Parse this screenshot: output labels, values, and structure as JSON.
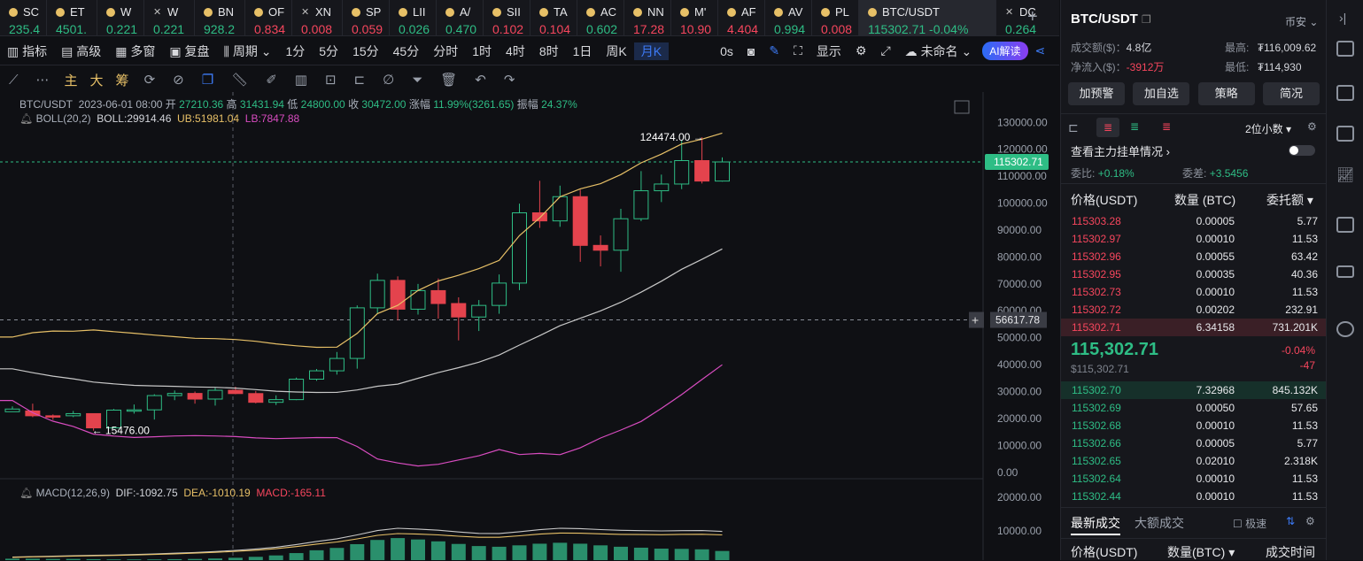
{
  "tabs": [
    {
      "name": "SC",
      "price": "235.4",
      "dir": "up",
      "icon": "dot"
    },
    {
      "name": "ET",
      "price": "4501.",
      "dir": "up",
      "icon": "dot"
    },
    {
      "name": "W",
      "price": "0.221",
      "dir": "up",
      "icon": "dot"
    },
    {
      "name": "W",
      "price": "0.221",
      "dir": "up",
      "icon": "x"
    },
    {
      "name": "BN",
      "price": "928.2",
      "dir": "up",
      "icon": "dot"
    },
    {
      "name": "OF",
      "price": "0.834",
      "dir": "dn",
      "icon": "dot"
    },
    {
      "name": "XN",
      "price": "0.008",
      "dir": "dn",
      "icon": "x"
    },
    {
      "name": "SP",
      "price": "0.059",
      "dir": "dn",
      "icon": "dot"
    },
    {
      "name": "LII",
      "price": "0.026",
      "dir": "up",
      "icon": "dot"
    },
    {
      "name": "A/",
      "price": "0.470",
      "dir": "up",
      "icon": "dot"
    },
    {
      "name": "SII",
      "price": "0.102",
      "dir": "dn",
      "icon": "dot"
    },
    {
      "name": "TA",
      "price": "0.104",
      "dir": "dn",
      "icon": "dot"
    },
    {
      "name": "AC",
      "price": "0.602",
      "dir": "up",
      "icon": "dot"
    },
    {
      "name": "NN",
      "price": "17.28",
      "dir": "dn",
      "icon": "dot"
    },
    {
      "name": "M'",
      "price": "10.90",
      "dir": "dn",
      "icon": "dot"
    },
    {
      "name": "AF",
      "price": "4.404",
      "dir": "dn",
      "icon": "dot"
    },
    {
      "name": "AV",
      "price": "0.994",
      "dir": "up",
      "icon": "dot"
    },
    {
      "name": "PL",
      "price": "0.008",
      "dir": "dn",
      "icon": "dot"
    }
  ],
  "active_tab": {
    "name": "BTC/USDT",
    "price": "115302.71",
    "change": "-0.04%"
  },
  "tail_tab": {
    "name": "DC",
    "price": "0.264",
    "icon": "x"
  },
  "toolbar": {
    "indicators": "指标",
    "advanced": "高级",
    "multi": "多窗",
    "replay": "复盘",
    "period": "周期",
    "intervals": [
      "1分",
      "5分",
      "15分",
      "45分",
      "分时",
      "1时",
      "4时",
      "8时",
      "1日",
      "周K",
      "月K"
    ],
    "active_interval": "月K",
    "seconds": "0s",
    "display": "显示",
    "unnamed": "未命名",
    "ai": "AI解读"
  },
  "drawbar": {
    "main": "主",
    "big": "大",
    "chip": "筹"
  },
  "info": {
    "symbol": "BTC/USDT",
    "date": "2023-06-01 08:00",
    "open_l": "开",
    "open": "27210.36",
    "high_l": "高",
    "high": "31431.94",
    "low_l": "低",
    "low": "24800.00",
    "close_l": "收",
    "close": "30472.00",
    "chg_l": "涨幅",
    "chg": "11.99%(3261.65)",
    "amp_l": "振幅",
    "amp": "24.37%"
  },
  "boll": {
    "label": "BOLL(20,2)",
    "mid": "BOLL:29914.46",
    "ub": "UB:51981.04",
    "lb": "LB:7847.88"
  },
  "macd": {
    "label": "MACD(12,26,9)",
    "dif": "DIF:-1092.75",
    "dea": "DEA:-1010.19",
    "macd": "MACD:-165.11"
  },
  "chart_data": {
    "type": "candlestick",
    "title": "BTC/USDT 月K",
    "y_ticks": [
      130000,
      120000,
      110000,
      100000,
      90000,
      80000,
      70000,
      60000,
      50000,
      40000,
      30000,
      20000,
      10000,
      0
    ],
    "macd_ticks": [
      20000,
      10000
    ],
    "current_price": "115302.71",
    "cross_price": "56617.78",
    "max_label": "124474.00",
    "min_label": "15476.00",
    "candles": [
      [
        22500,
        23500,
        22800,
        24500,
        "up"
      ],
      [
        22800,
        21000,
        20500,
        25500,
        "dn"
      ],
      [
        21000,
        20500,
        19500,
        21500,
        "dn"
      ],
      [
        21000,
        21800,
        20500,
        22800,
        "up"
      ],
      [
        21800,
        16500,
        15476,
        21900,
        "dn"
      ],
      [
        16500,
        23100,
        16500,
        23500,
        "up"
      ],
      [
        23100,
        23200,
        21800,
        25200,
        "up"
      ],
      [
        23200,
        28500,
        19600,
        29000,
        "up"
      ],
      [
        28500,
        29300,
        26800,
        30400,
        "up"
      ],
      [
        29300,
        27200,
        25500,
        30000,
        "dn"
      ],
      [
        27210,
        30472,
        24800,
        31432,
        "up"
      ],
      [
        30472,
        29250,
        29000,
        31800,
        "dn"
      ],
      [
        29250,
        26000,
        25600,
        30200,
        "dn"
      ],
      [
        26000,
        27000,
        25000,
        28600,
        "up"
      ],
      [
        27000,
        34600,
        26800,
        35200,
        "up"
      ],
      [
        34600,
        37700,
        34000,
        38400,
        "up"
      ],
      [
        37700,
        42300,
        36300,
        44700,
        "up"
      ],
      [
        42300,
        61100,
        38500,
        62000,
        "up"
      ],
      [
        61100,
        71300,
        59000,
        73800,
        "up"
      ],
      [
        71300,
        60600,
        56500,
        72800,
        "dn"
      ],
      [
        60600,
        67500,
        58600,
        70000,
        "up"
      ],
      [
        67500,
        62700,
        57100,
        72000,
        "dn"
      ],
      [
        62700,
        57700,
        49000,
        65000,
        "dn"
      ],
      [
        57700,
        62000,
        52500,
        64000,
        "up"
      ],
      [
        62000,
        70300,
        58900,
        73500,
        "up"
      ],
      [
        70300,
        96400,
        67700,
        99800,
        "up"
      ],
      [
        96400,
        93400,
        90800,
        108300,
        "dn"
      ],
      [
        93400,
        102400,
        91200,
        106500,
        "up"
      ],
      [
        102400,
        84300,
        78200,
        105000,
        "dn"
      ],
      [
        84300,
        82500,
        76500,
        88000,
        "dn"
      ],
      [
        82500,
        94200,
        74500,
        97900,
        "up"
      ],
      [
        94200,
        104600,
        93300,
        111900,
        "up"
      ],
      [
        104600,
        107100,
        100400,
        110600,
        "up"
      ],
      [
        107100,
        115800,
        105200,
        123200,
        "up"
      ],
      [
        115800,
        108200,
        107300,
        124474,
        "dn"
      ],
      [
        108200,
        115302,
        108000,
        117000,
        "up"
      ]
    ],
    "macd_hist": [
      600,
      600,
      500,
      500,
      400,
      300,
      300,
      300,
      400,
      500,
      700,
      1000,
      1400,
      2000,
      3000,
      4200,
      5200,
      6800,
      8600,
      9400,
      8800,
      8000,
      6900,
      6000,
      5700,
      6300,
      7000,
      7400,
      7000,
      6300,
      5700,
      5300,
      4900,
      4800,
      4600,
      3900
    ]
  },
  "panel": {
    "symbol": "BTC/USDT",
    "coin_label": "币安",
    "vol_label": "成交额($)：",
    "vol": "4.8亿",
    "inflow_label": "净流入($)：",
    "inflow": "-3912万",
    "high_label": "最高:",
    "high": "₮116,009.62",
    "low_label": "最低:",
    "low": "₮114,930",
    "buttons": [
      "加预警",
      "加自选",
      "策略",
      "简况"
    ],
    "decimals": "2位小数",
    "view_orders": "查看主力挂单情况",
    "ratio_label": "委比:",
    "ratio": "+0.18%",
    "diff_label": "委差:",
    "diff": "+3.5456",
    "col_price": "价格(USDT)",
    "col_qty": "数量 (BTC)",
    "col_total": "委托额",
    "asks": [
      [
        "115303.28",
        "0.00005",
        "5.77"
      ],
      [
        "115302.97",
        "0.00010",
        "11.53"
      ],
      [
        "115302.96",
        "0.00055",
        "63.42"
      ],
      [
        "115302.95",
        "0.00035",
        "40.36"
      ],
      [
        "115302.73",
        "0.00010",
        "11.53"
      ],
      [
        "115302.72",
        "0.00202",
        "232.91"
      ],
      [
        "115302.71",
        "6.34158",
        "731.201K"
      ]
    ],
    "last_price": "115,302.71",
    "last_usd": "$115,302.71",
    "last_pct": "-0.04%",
    "last_chg": "-47",
    "bids": [
      [
        "115302.70",
        "7.32968",
        "845.132K"
      ],
      [
        "115302.69",
        "0.00050",
        "57.65"
      ],
      [
        "115302.68",
        "0.00010",
        "11.53"
      ],
      [
        "115302.66",
        "0.00005",
        "5.77"
      ],
      [
        "115302.65",
        "0.02010",
        "2.318K"
      ],
      [
        "115302.64",
        "0.00010",
        "11.53"
      ],
      [
        "115302.44",
        "0.00010",
        "11.53"
      ]
    ],
    "trades_tab": "最新成交",
    "big_tab": "大额成交",
    "fast": "极速",
    "t_col_price": "价格(USDT)",
    "t_col_qty": "数量(BTC)",
    "t_col_time": "成交时间"
  },
  "colors": {
    "up": "#2ebd85",
    "down": "#f6465d",
    "boll_ub": "#e7c067",
    "boll_lb": "#d84cc0",
    "boll_mid": "#c8c8c8"
  }
}
